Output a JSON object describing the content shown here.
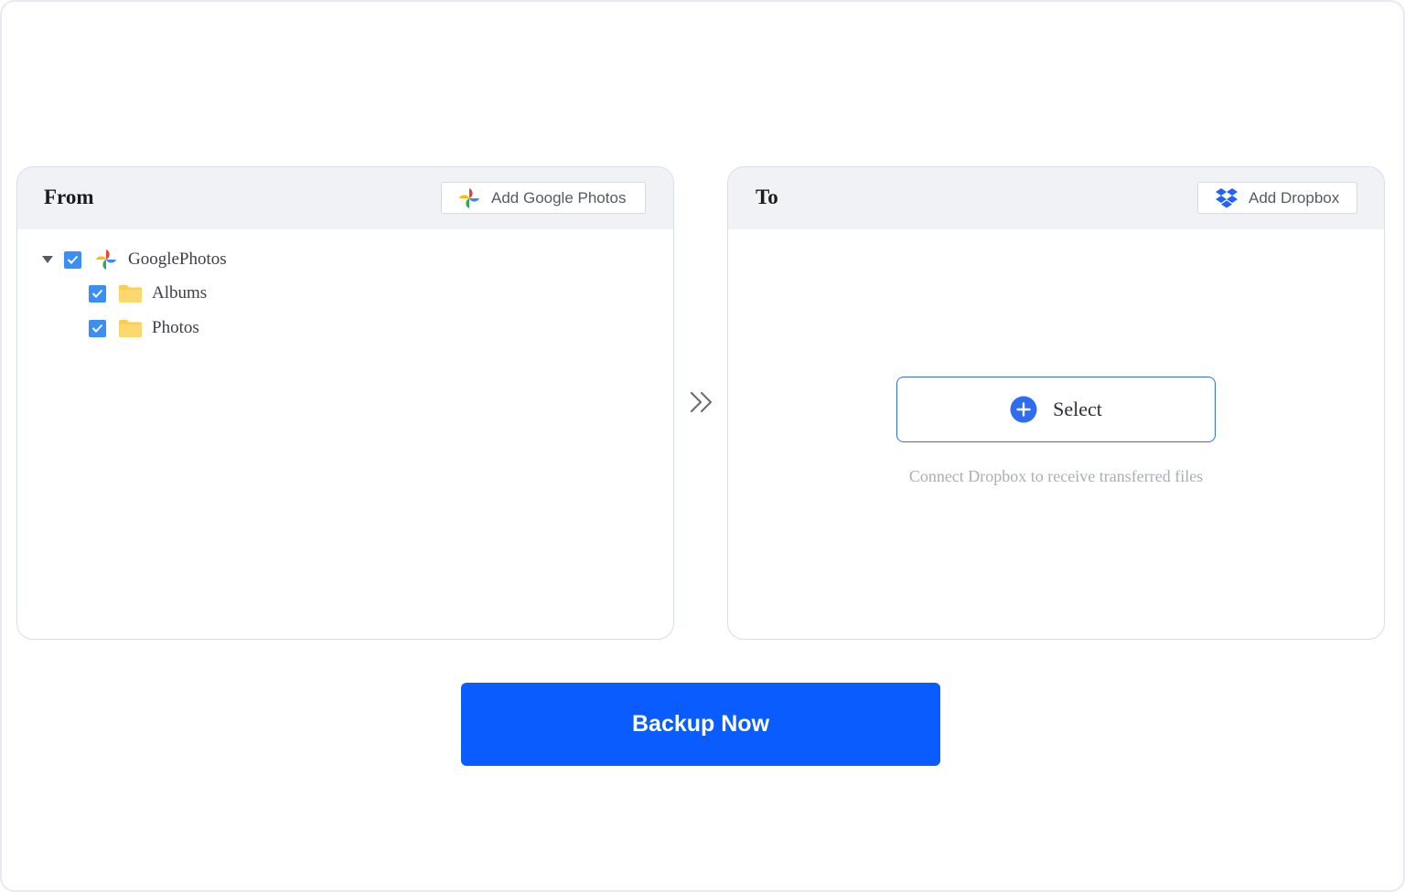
{
  "source_panel": {
    "title": "From",
    "add_button_label": "Add Google Photos",
    "add_button_icon": "google-photos-icon",
    "tree": {
      "root": {
        "label": "GooglePhotos",
        "checked": true,
        "expanded": true,
        "icon": "google-photos-icon"
      },
      "children": [
        {
          "label": "Albums",
          "checked": true,
          "icon": "folder-icon"
        },
        {
          "label": "Photos",
          "checked": true,
          "icon": "folder-icon"
        }
      ]
    }
  },
  "transfer_arrow_icon": "double-chevron-right-icon",
  "destination_panel": {
    "title": "To",
    "add_button_label": "Add Dropbox",
    "add_button_icon": "dropbox-icon",
    "select_button_label": "Select",
    "select_button_icon": "plus-circle-icon",
    "hint": "Connect Dropbox to receive transferred files"
  },
  "primary_action": {
    "label": "Backup Now"
  },
  "colors": {
    "primary": "#0a5cff",
    "checkbox": "#3b8ef5",
    "folder": "#fccd55",
    "header_bg": "#f0f2f6",
    "dropbox": "#1f62ff",
    "hint_text": "#a9adb5"
  }
}
